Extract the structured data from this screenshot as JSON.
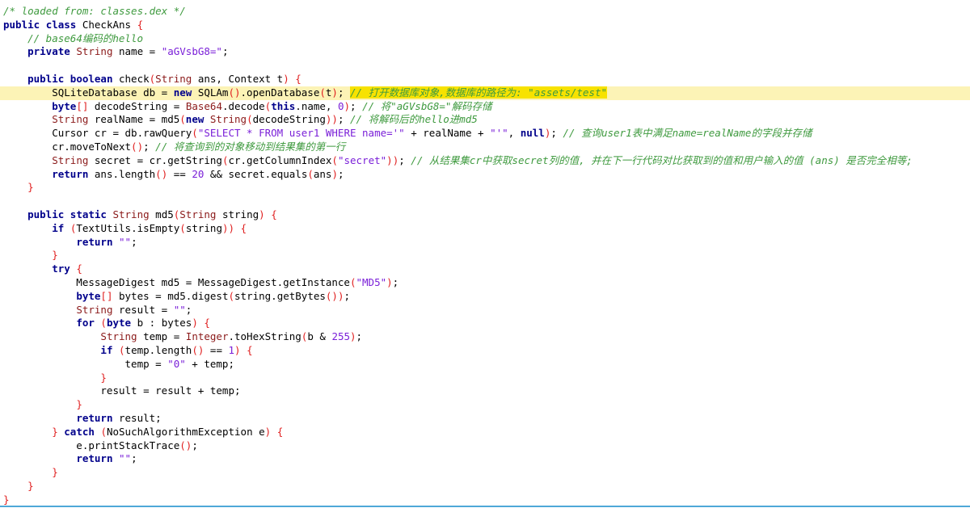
{
  "code_lines": [
    {
      "tokens": [
        {
          "t": "/* loaded from: classes.dex */",
          "c": "cm"
        }
      ]
    },
    {
      "tokens": [
        {
          "t": "public",
          "c": "kw"
        },
        {
          "t": " "
        },
        {
          "t": "class",
          "c": "kw"
        },
        {
          "t": " CheckAns "
        },
        {
          "t": "{",
          "c": "br"
        }
      ]
    },
    {
      "tokens": [
        {
          "t": "    "
        },
        {
          "t": "// base64编码的hello",
          "c": "cm"
        }
      ]
    },
    {
      "tokens": [
        {
          "t": "    "
        },
        {
          "t": "private",
          "c": "kw"
        },
        {
          "t": " "
        },
        {
          "t": "String",
          "c": "tp"
        },
        {
          "t": " name = "
        },
        {
          "t": "\"aGVsbG8=\"",
          "c": "st"
        },
        {
          "t": ";"
        }
      ]
    },
    {
      "tokens": []
    },
    {
      "tokens": [
        {
          "t": "    "
        },
        {
          "t": "public",
          "c": "kw"
        },
        {
          "t": " "
        },
        {
          "t": "boolean",
          "c": "kw"
        },
        {
          "t": " check"
        },
        {
          "t": "(",
          "c": "br"
        },
        {
          "t": "String",
          "c": "tp"
        },
        {
          "t": " ans, Context t"
        },
        {
          "t": ")",
          "c": "br"
        },
        {
          "t": " "
        },
        {
          "t": "{",
          "c": "br"
        }
      ]
    },
    {
      "highlight": true,
      "tokens": [
        {
          "t": "        SQLiteDatabase db = "
        },
        {
          "t": "new",
          "c": "kw"
        },
        {
          "t": " SQLAm"
        },
        {
          "t": "()",
          "c": "br"
        },
        {
          "t": ".openDatabase"
        },
        {
          "t": "(",
          "c": "br"
        },
        {
          "t": "t"
        },
        {
          "t": ")",
          "c": "br"
        },
        {
          "t": "; "
        },
        {
          "t": "// 打开数据库对象,数据库的路径为: \"assets/test\"",
          "c": "cm cmhl"
        }
      ]
    },
    {
      "tokens": [
        {
          "t": "        "
        },
        {
          "t": "byte",
          "c": "kw"
        },
        {
          "t": "[]",
          "c": "br"
        },
        {
          "t": " decodeString = "
        },
        {
          "t": "Base64",
          "c": "tp"
        },
        {
          "t": ".decode"
        },
        {
          "t": "(",
          "c": "br"
        },
        {
          "t": "this",
          "c": "kw"
        },
        {
          "t": ".name, "
        },
        {
          "t": "0",
          "c": "nm"
        },
        {
          "t": ")",
          "c": "br"
        },
        {
          "t": "; "
        },
        {
          "t": "// 将\"aGVsbG8=\"解码存储",
          "c": "cm"
        }
      ]
    },
    {
      "tokens": [
        {
          "t": "        "
        },
        {
          "t": "String",
          "c": "tp"
        },
        {
          "t": " realName = md5"
        },
        {
          "t": "(",
          "c": "br"
        },
        {
          "t": "new",
          "c": "kw"
        },
        {
          "t": " "
        },
        {
          "t": "String",
          "c": "tp"
        },
        {
          "t": "(",
          "c": "br"
        },
        {
          "t": "decodeString"
        },
        {
          "t": "))",
          "c": "br"
        },
        {
          "t": "; "
        },
        {
          "t": "// 将解码后的hello进md5",
          "c": "cm"
        }
      ]
    },
    {
      "tokens": [
        {
          "t": "        Cursor cr = db.rawQuery"
        },
        {
          "t": "(",
          "c": "br"
        },
        {
          "t": "\"SELECT * FROM user1 WHERE name='\"",
          "c": "st"
        },
        {
          "t": " + realName + "
        },
        {
          "t": "\"'\"",
          "c": "st"
        },
        {
          "t": ", "
        },
        {
          "t": "null",
          "c": "kw"
        },
        {
          "t": ")",
          "c": "br"
        },
        {
          "t": "; "
        },
        {
          "t": "// 查询user1表中满足name=realName的字段并存储",
          "c": "cm"
        }
      ]
    },
    {
      "tokens": [
        {
          "t": "        cr.moveToNext"
        },
        {
          "t": "()",
          "c": "br"
        },
        {
          "t": "; "
        },
        {
          "t": "// 将查询到的对象移动到结果集的第一行",
          "c": "cm"
        }
      ]
    },
    {
      "tokens": [
        {
          "t": "        "
        },
        {
          "t": "String",
          "c": "tp"
        },
        {
          "t": " secret = cr.getString"
        },
        {
          "t": "(",
          "c": "br"
        },
        {
          "t": "cr.getColumnIndex"
        },
        {
          "t": "(",
          "c": "br"
        },
        {
          "t": "\"secret\"",
          "c": "st"
        },
        {
          "t": "))",
          "c": "br"
        },
        {
          "t": "; "
        },
        {
          "t": "// 从结果集cr中获取secret列的值, 并在下一行代码对比获取到的值和用户输入的值 (ans) 是否完全相等;",
          "c": "cm"
        }
      ]
    },
    {
      "tokens": [
        {
          "t": "        "
        },
        {
          "t": "return",
          "c": "kw"
        },
        {
          "t": " ans.length"
        },
        {
          "t": "()",
          "c": "br"
        },
        {
          "t": " == "
        },
        {
          "t": "20",
          "c": "nm"
        },
        {
          "t": " && secret.equals"
        },
        {
          "t": "(",
          "c": "br"
        },
        {
          "t": "ans"
        },
        {
          "t": ")",
          "c": "br"
        },
        {
          "t": ";"
        }
      ]
    },
    {
      "tokens": [
        {
          "t": "    "
        },
        {
          "t": "}",
          "c": "br"
        }
      ]
    },
    {
      "tokens": []
    },
    {
      "tokens": [
        {
          "t": "    "
        },
        {
          "t": "public",
          "c": "kw"
        },
        {
          "t": " "
        },
        {
          "t": "static",
          "c": "kw"
        },
        {
          "t": " "
        },
        {
          "t": "String",
          "c": "tp"
        },
        {
          "t": " md5"
        },
        {
          "t": "(",
          "c": "br"
        },
        {
          "t": "String",
          "c": "tp"
        },
        {
          "t": " string"
        },
        {
          "t": ")",
          "c": "br"
        },
        {
          "t": " "
        },
        {
          "t": "{",
          "c": "br"
        }
      ]
    },
    {
      "tokens": [
        {
          "t": "        "
        },
        {
          "t": "if",
          "c": "kw"
        },
        {
          "t": " "
        },
        {
          "t": "(",
          "c": "br"
        },
        {
          "t": "TextUtils.isEmpty"
        },
        {
          "t": "(",
          "c": "br"
        },
        {
          "t": "string"
        },
        {
          "t": "))",
          "c": "br"
        },
        {
          "t": " "
        },
        {
          "t": "{",
          "c": "br"
        }
      ]
    },
    {
      "tokens": [
        {
          "t": "            "
        },
        {
          "t": "return",
          "c": "kw"
        },
        {
          "t": " "
        },
        {
          "t": "\"\"",
          "c": "st"
        },
        {
          "t": ";"
        }
      ]
    },
    {
      "tokens": [
        {
          "t": "        "
        },
        {
          "t": "}",
          "c": "br"
        }
      ]
    },
    {
      "tokens": [
        {
          "t": "        "
        },
        {
          "t": "try",
          "c": "kw"
        },
        {
          "t": " "
        },
        {
          "t": "{",
          "c": "br"
        }
      ]
    },
    {
      "tokens": [
        {
          "t": "            MessageDigest md5 = MessageDigest.getInstance"
        },
        {
          "t": "(",
          "c": "br"
        },
        {
          "t": "\"MD5\"",
          "c": "st"
        },
        {
          "t": ")",
          "c": "br"
        },
        {
          "t": ";"
        }
      ]
    },
    {
      "tokens": [
        {
          "t": "            "
        },
        {
          "t": "byte",
          "c": "kw"
        },
        {
          "t": "[]",
          "c": "br"
        },
        {
          "t": " bytes = md5.digest"
        },
        {
          "t": "(",
          "c": "br"
        },
        {
          "t": "string.getBytes"
        },
        {
          "t": "())",
          "c": "br"
        },
        {
          "t": ";"
        }
      ]
    },
    {
      "tokens": [
        {
          "t": "            "
        },
        {
          "t": "String",
          "c": "tp"
        },
        {
          "t": " result = "
        },
        {
          "t": "\"\"",
          "c": "st"
        },
        {
          "t": ";"
        }
      ]
    },
    {
      "tokens": [
        {
          "t": "            "
        },
        {
          "t": "for",
          "c": "kw"
        },
        {
          "t": " "
        },
        {
          "t": "(",
          "c": "br"
        },
        {
          "t": "byte",
          "c": "kw"
        },
        {
          "t": " b : bytes"
        },
        {
          "t": ")",
          "c": "br"
        },
        {
          "t": " "
        },
        {
          "t": "{",
          "c": "br"
        }
      ]
    },
    {
      "tokens": [
        {
          "t": "                "
        },
        {
          "t": "String",
          "c": "tp"
        },
        {
          "t": " temp = "
        },
        {
          "t": "Integer",
          "c": "tp"
        },
        {
          "t": ".toHexString"
        },
        {
          "t": "(",
          "c": "br"
        },
        {
          "t": "b & "
        },
        {
          "t": "255",
          "c": "nm"
        },
        {
          "t": ")",
          "c": "br"
        },
        {
          "t": ";"
        }
      ]
    },
    {
      "tokens": [
        {
          "t": "                "
        },
        {
          "t": "if",
          "c": "kw"
        },
        {
          "t": " "
        },
        {
          "t": "(",
          "c": "br"
        },
        {
          "t": "temp.length"
        },
        {
          "t": "()",
          "c": "br"
        },
        {
          "t": " == "
        },
        {
          "t": "1",
          "c": "nm"
        },
        {
          "t": ")",
          "c": "br"
        },
        {
          "t": " "
        },
        {
          "t": "{",
          "c": "br"
        }
      ]
    },
    {
      "tokens": [
        {
          "t": "                    temp = "
        },
        {
          "t": "\"0\"",
          "c": "st"
        },
        {
          "t": " + temp;"
        }
      ]
    },
    {
      "tokens": [
        {
          "t": "                "
        },
        {
          "t": "}",
          "c": "br"
        }
      ]
    },
    {
      "tokens": [
        {
          "t": "                result = result + temp;"
        }
      ]
    },
    {
      "tokens": [
        {
          "t": "            "
        },
        {
          "t": "}",
          "c": "br"
        }
      ]
    },
    {
      "tokens": [
        {
          "t": "            "
        },
        {
          "t": "return",
          "c": "kw"
        },
        {
          "t": " result;"
        }
      ]
    },
    {
      "tokens": [
        {
          "t": "        "
        },
        {
          "t": "}",
          "c": "br"
        },
        {
          "t": " "
        },
        {
          "t": "catch",
          "c": "kw"
        },
        {
          "t": " "
        },
        {
          "t": "(",
          "c": "br"
        },
        {
          "t": "NoSuchAlgorithmException e"
        },
        {
          "t": ")",
          "c": "br"
        },
        {
          "t": " "
        },
        {
          "t": "{",
          "c": "br"
        }
      ]
    },
    {
      "tokens": [
        {
          "t": "            e.printStackTrace"
        },
        {
          "t": "()",
          "c": "br"
        },
        {
          "t": ";"
        }
      ]
    },
    {
      "tokens": [
        {
          "t": "            "
        },
        {
          "t": "return",
          "c": "kw"
        },
        {
          "t": " "
        },
        {
          "t": "\"\"",
          "c": "st"
        },
        {
          "t": ";"
        }
      ]
    },
    {
      "tokens": [
        {
          "t": "        "
        },
        {
          "t": "}",
          "c": "br"
        }
      ]
    },
    {
      "tokens": [
        {
          "t": "    "
        },
        {
          "t": "}",
          "c": "br"
        }
      ]
    },
    {
      "tokens": [
        {
          "t": "}",
          "c": "br"
        }
      ]
    }
  ],
  "colors": {
    "keyword": "#00008b",
    "comment": "#3f9a3f",
    "string": "#7a1fd8",
    "type": "#8b1a1a",
    "bracket": "#e02020",
    "line_highlight": "#fcf3b6",
    "comment_highlight": "#f7e200",
    "bottom_rule": "#4ea8d8"
  }
}
